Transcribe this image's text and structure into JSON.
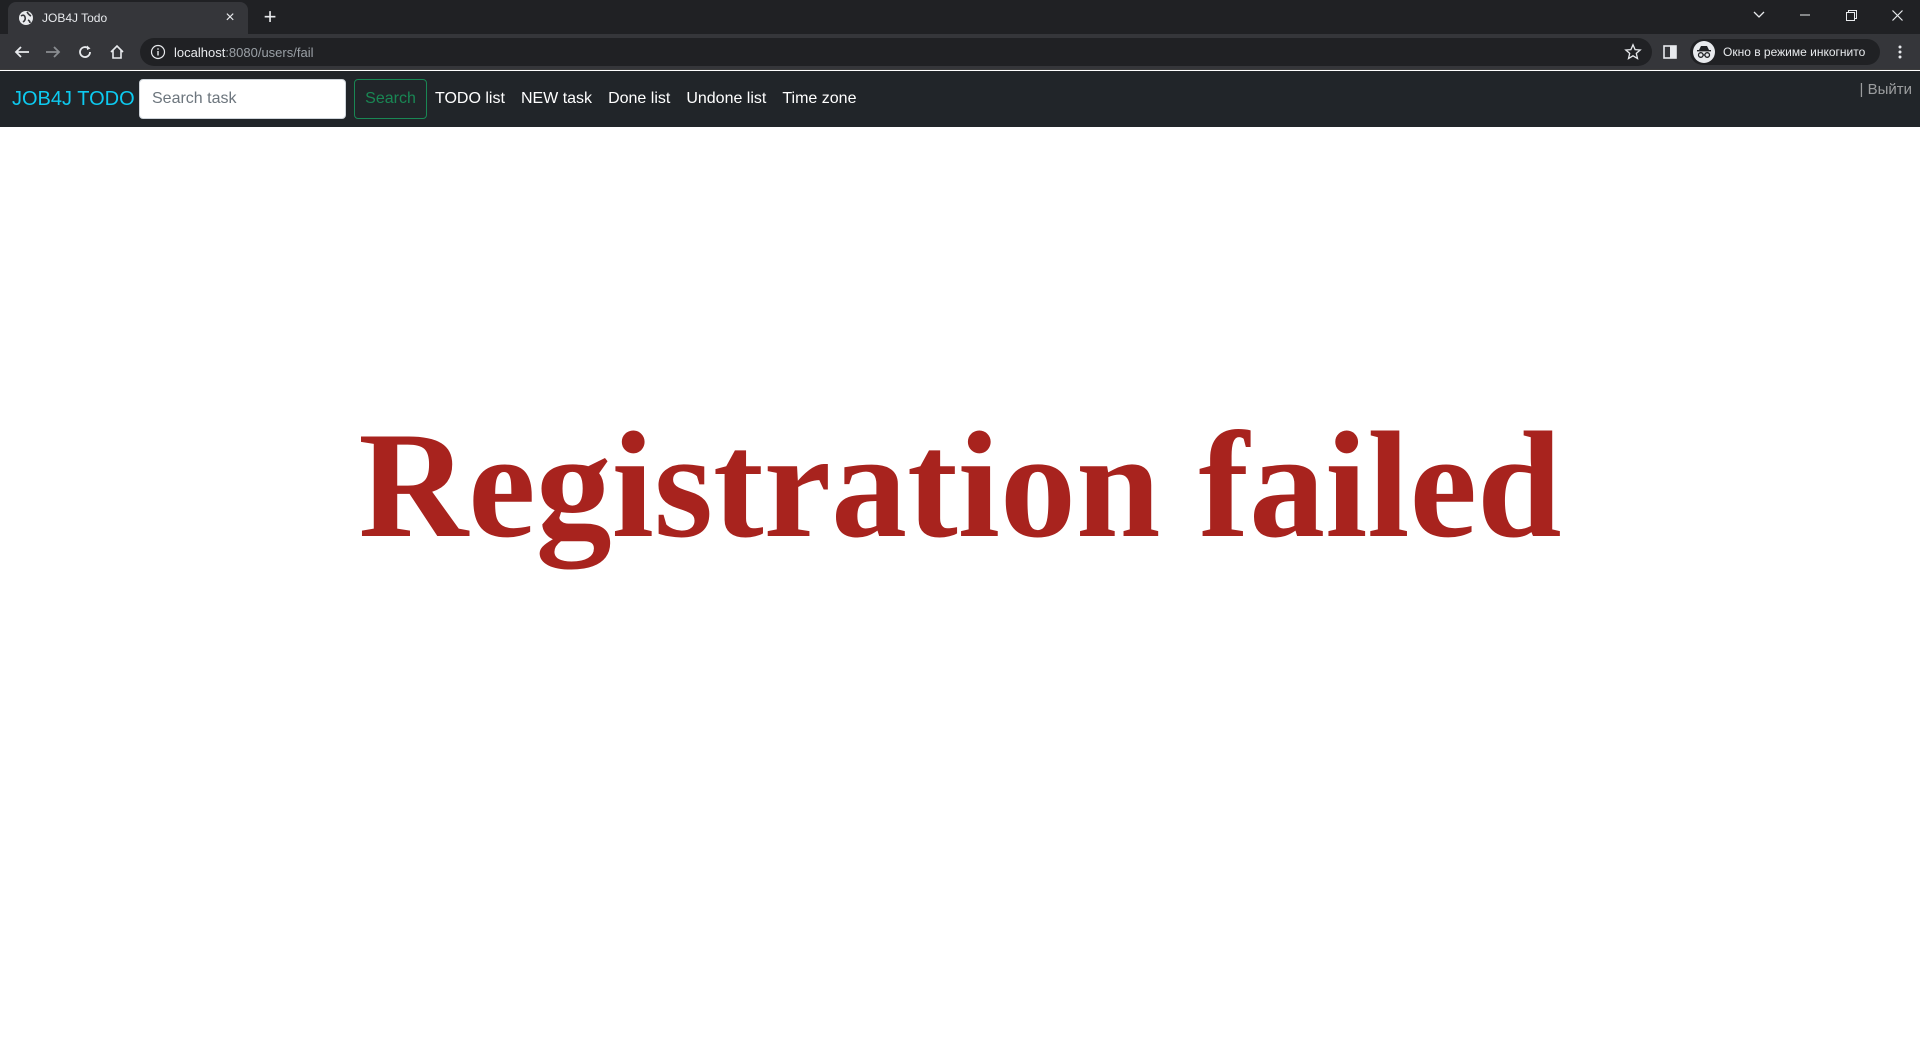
{
  "browser": {
    "tab": {
      "title": "JOB4J Todo",
      "favicon": "globe-icon"
    },
    "address": {
      "host": "localhost",
      "rest": ":8080/users/fail"
    },
    "incognito_label": "Окно в режиме инкогнито"
  },
  "navbar": {
    "brand": "JOB4J TODO",
    "search": {
      "placeholder": "Search task",
      "value": "",
      "button": "Search"
    },
    "links": [
      "TODO list",
      "NEW task",
      "Done list",
      "Undone list",
      "Time zone"
    ],
    "logout": "| Выйти"
  },
  "main": {
    "message": "Registration failed"
  },
  "colors": {
    "chrome_dark": "#202124",
    "chrome_toolbar": "#35363a",
    "navbar_bg": "#212529",
    "brand": "#0dcaf0",
    "search_button": "#198754",
    "message": "#a8231e"
  }
}
